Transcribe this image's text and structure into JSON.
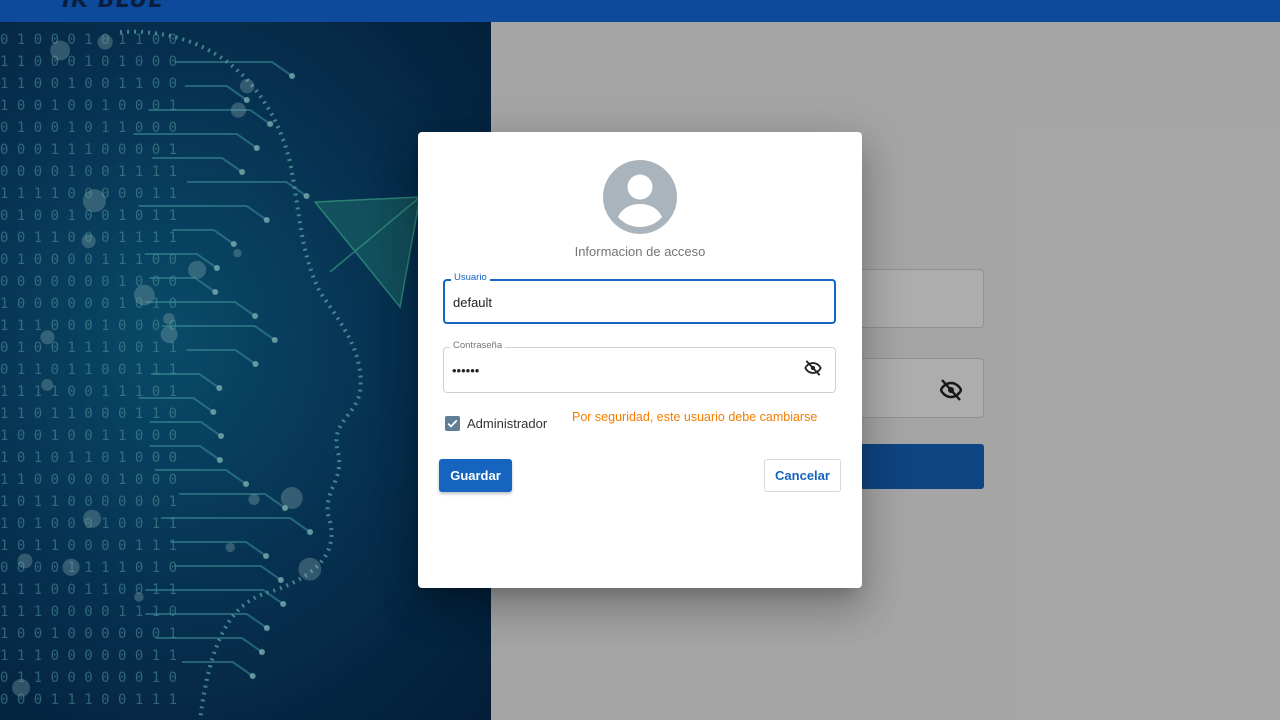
{
  "header": {
    "logo_text": "IK BLUE"
  },
  "dialog": {
    "caption": "Informacion de acceso",
    "username": {
      "label": "Usuario",
      "value": "default"
    },
    "password": {
      "label": "Contraseña",
      "value": "••••••"
    },
    "admin_checkbox": {
      "label": "Administrador",
      "checked": true
    },
    "warning": "Por seguridad, este usuario debe cambiarse",
    "save_label": "Guardar",
    "cancel_label": "Cancelar"
  },
  "colors": {
    "primary": "#1565c0",
    "warning": "#f57c00",
    "topbar": "#0d4a9c"
  },
  "icons": [
    "account-circle-icon",
    "eye-off-icon",
    "check-icon"
  ]
}
